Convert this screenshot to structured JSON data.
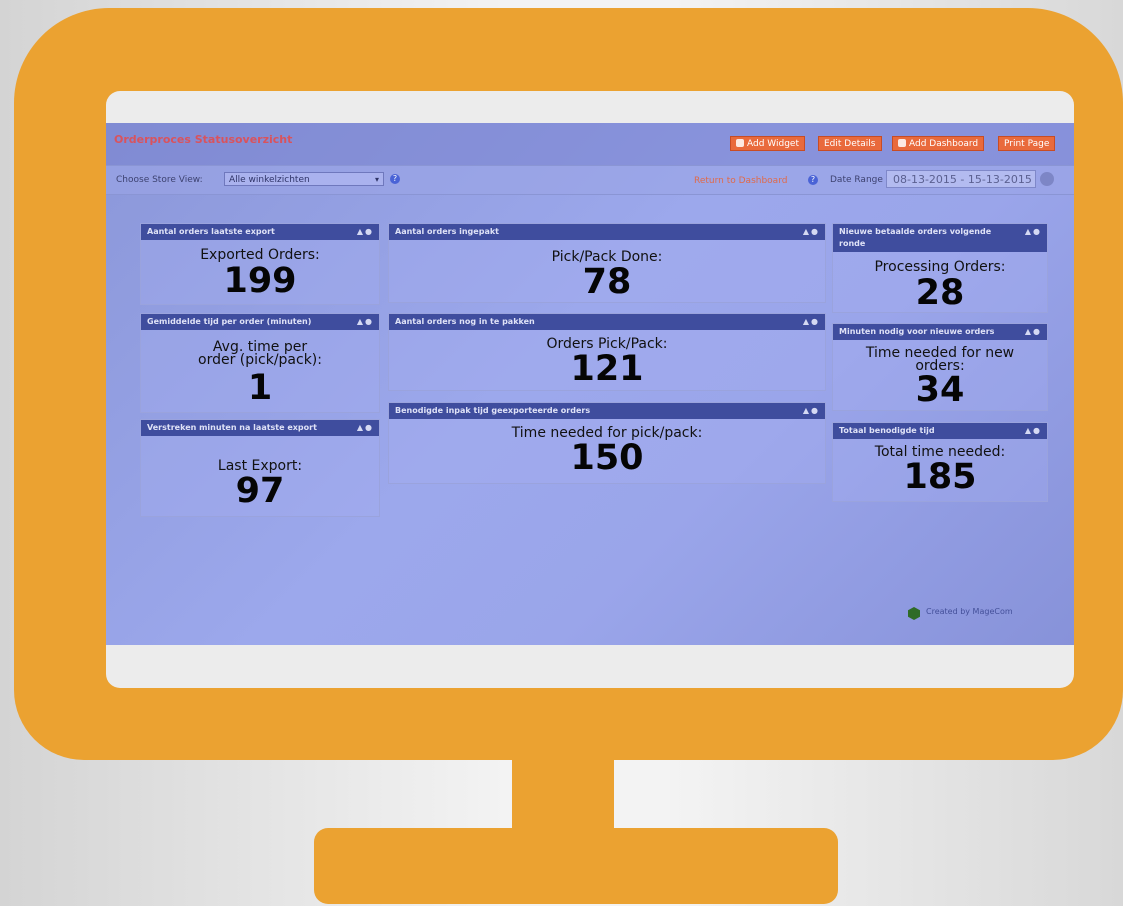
{
  "header": {
    "title": "Orderproces Statusoverzicht",
    "buttons": {
      "add_widget": "Add Widget",
      "edit_details": "Edit Details",
      "add_dashboard": "Add Dashboard",
      "print_page": "Print Page"
    }
  },
  "filters": {
    "store_view_label": "Choose Store View:",
    "store_view_value": "Alle winkelzichten",
    "return_link": "Return to Dashboard",
    "date_range_label": "Date Range",
    "date_range_value": "08-13-2015 - 15-13-2015"
  },
  "widgets": [
    {
      "title": "Aantal orders laatste export",
      "label": "Exported Orders:",
      "value": "199"
    },
    {
      "title": "Gemiddelde tijd per order (minuten)",
      "label": "Avg. time per order (pick/pack):",
      "value": "1"
    },
    {
      "title": "Verstreken minuten na laatste export",
      "label": "Last Export:",
      "value": "97"
    },
    {
      "title": "Aantal orders ingepakt",
      "label": "Pick/Pack Done:",
      "value": "78"
    },
    {
      "title": "Aantal orders nog in te pakken",
      "label": "Orders Pick/Pack:",
      "value": "121"
    },
    {
      "title": "Benodigde inpak tijd geexporteerde orders",
      "label": "Time needed for pick/pack:",
      "value": "150"
    },
    {
      "title": "Nieuwe betaalde orders volgende ronde",
      "label": "Processing Orders:",
      "value": "28"
    },
    {
      "title": "Minuten nodig voor nieuwe orders",
      "label": "Time needed for new orders:",
      "value": "34"
    },
    {
      "title": "Totaal benodigde tijd",
      "label": "Total time needed:",
      "value": "185"
    }
  ],
  "footer": {
    "credit": "Created by MageCom"
  },
  "colors": {
    "frame": "#eba231",
    "widget_header": "#3f4d9e",
    "button": "#e96a3c",
    "title": "#d9535d"
  }
}
